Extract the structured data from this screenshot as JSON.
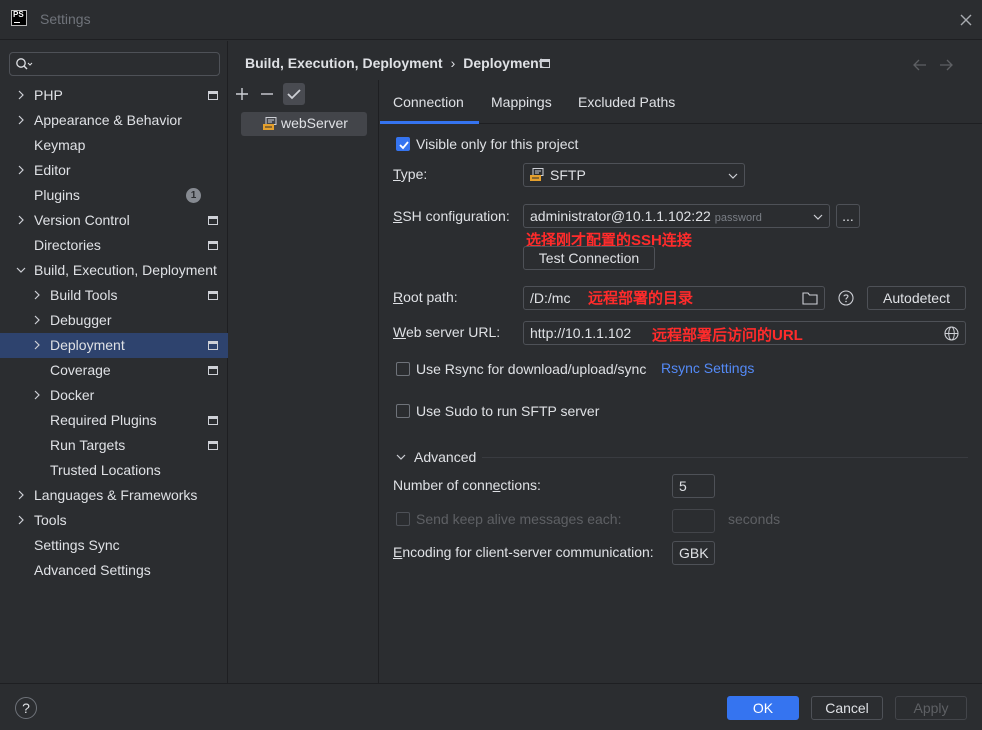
{
  "window": {
    "title": "Settings",
    "logo_text": "PS"
  },
  "search": {
    "placeholder": "",
    "value": ""
  },
  "sidebar": {
    "items": [
      {
        "label": "PHP"
      },
      {
        "label": "Appearance & Behavior"
      },
      {
        "label": "Keymap"
      },
      {
        "label": "Editor"
      },
      {
        "label": "Plugins",
        "badge": "1"
      },
      {
        "label": "Version Control"
      },
      {
        "label": "Directories"
      },
      {
        "label": "Build, Execution, Deployment"
      },
      {
        "label": "Build Tools"
      },
      {
        "label": "Debugger"
      },
      {
        "label": "Deployment"
      },
      {
        "label": "Coverage"
      },
      {
        "label": "Docker"
      },
      {
        "label": "Required Plugins"
      },
      {
        "label": "Run Targets"
      },
      {
        "label": "Trusted Locations"
      },
      {
        "label": "Languages & Frameworks"
      },
      {
        "label": "Tools"
      },
      {
        "label": "Settings Sync"
      },
      {
        "label": "Advanced Settings"
      }
    ]
  },
  "breadcrumb": {
    "parent": "Build, Execution, Deployment",
    "separator": "›",
    "current": "Deployment"
  },
  "servers": {
    "items": [
      {
        "label": "webServer"
      }
    ]
  },
  "tabs": [
    {
      "label": "Connection"
    },
    {
      "label": "Mappings"
    },
    {
      "label": "Excluded Paths"
    }
  ],
  "connection": {
    "visible_only_label": "Visible only for this project",
    "type_label_first": "T",
    "type_label_rest": "ype:",
    "type_value": "SFTP",
    "ssh_label_first": "S",
    "ssh_label_rest": "SH configuration:",
    "ssh_value": "administrator@10.1.1.102:22",
    "ssh_hint": "password",
    "ssh_more": "...",
    "ssh_annotation": "选择刚才配置的SSH连接",
    "test_connection": "Test Connection",
    "root_label_first": "R",
    "root_label_rest": "oot path:",
    "root_value": "/D:/mc",
    "root_annotation": "远程部署的目录",
    "autodetect": "Autodetect",
    "web_label_first": "W",
    "web_label_rest": "eb server URL:",
    "web_value": "http://10.1.1.102",
    "web_annotation": "远程部署后访问的URL",
    "rsync_label": "Use Rsync for download/upload/sync",
    "rsync_settings": "Rsync Settings",
    "sudo_label": "Use Sudo to run SFTP server",
    "advanced_label": "Advanced",
    "connections_label_a": "Number of conn",
    "connections_label_u": "e",
    "connections_label_b": "ctions:",
    "connections_value": "5",
    "keepalive_label": "Send keep alive messages each:",
    "keepalive_value": "",
    "seconds_label": "seconds",
    "encoding_label_first": "E",
    "encoding_label_rest": "ncoding for client-server communication:",
    "encoding_value": "GBK"
  },
  "footer": {
    "help": "?",
    "ok": "OK",
    "cancel": "Cancel",
    "apply": "Apply"
  },
  "colors": {
    "accent": "#3574f0",
    "selection": "#2e436e",
    "annotation": "#ff2b2b",
    "link": "#548af7"
  },
  "icons": [
    "app-logo",
    "close-icon",
    "search-icon",
    "chevron-right-icon",
    "chevron-down-icon",
    "project-level-icon",
    "back-arrow-icon",
    "forward-arrow-icon",
    "plus-icon",
    "minus-icon",
    "check-icon",
    "sftp-server-icon",
    "folder-icon",
    "help-circle-icon",
    "globe-icon"
  ]
}
